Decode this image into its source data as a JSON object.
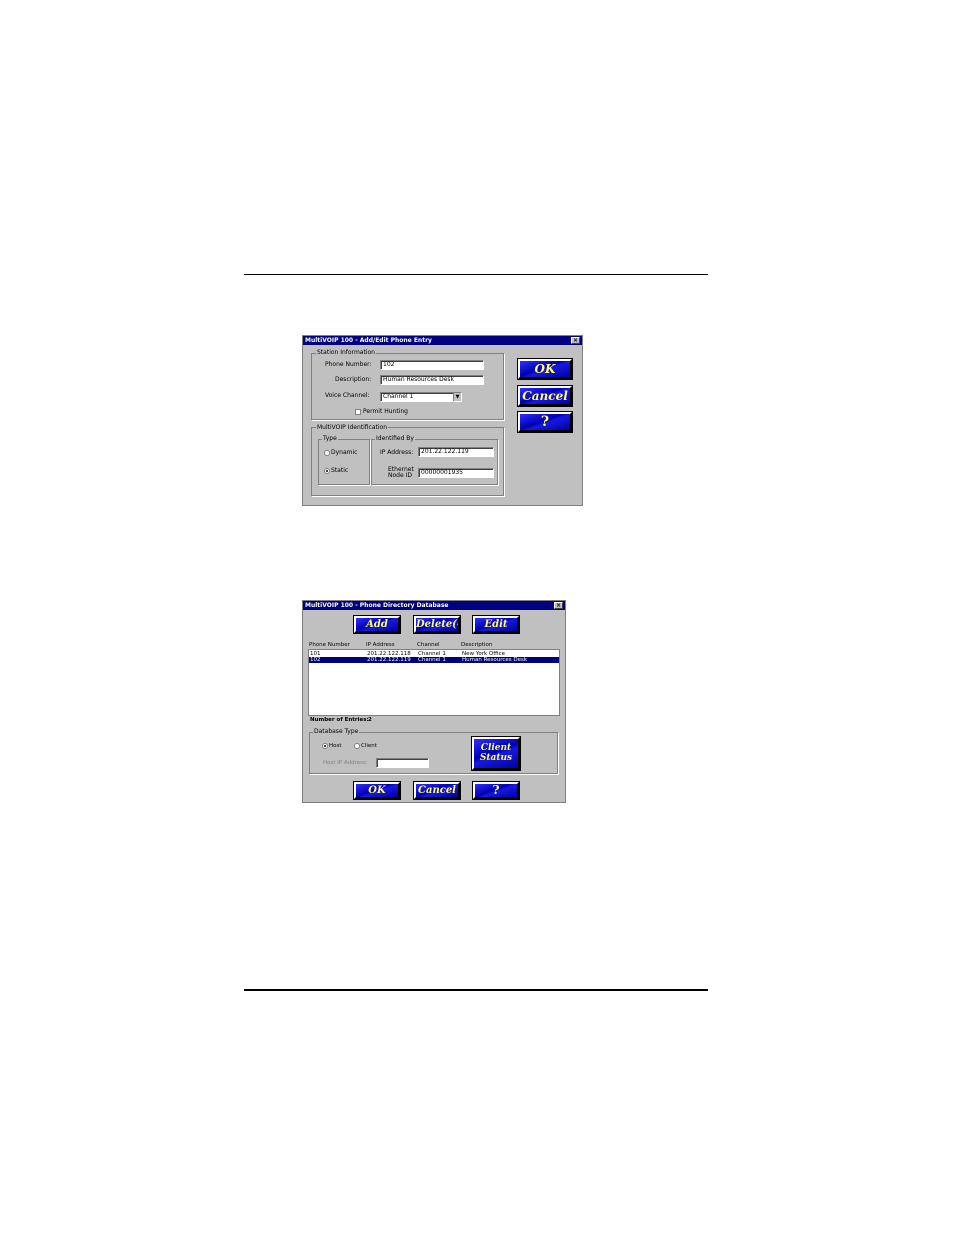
{
  "edit_dialog": {
    "title": "MultiVOIP 100 - Add/Edit Phone Entry",
    "close": "×",
    "station_group": "Station Information",
    "phone_number_label": "Phone Number:",
    "phone_number_value": "102",
    "description_label": "Description:",
    "description_value": "Human Resources Desk",
    "voice_channel_label": "Voice Channel:",
    "voice_channel_value": "Channel 1",
    "permit_hunting_label": "Permit Hunting",
    "id_group": "MultiVOIP Identification",
    "type_label": "Type",
    "identified_by_label": "Identified By",
    "dynamic_label": "Dynamic",
    "static_label": "Static",
    "ip_address_label": "IP Address:",
    "ip_address_value": "201.22.122.119",
    "ethernet_label_1": "Ethernet",
    "ethernet_label_2": "Node ID",
    "ethernet_value": "00000001935",
    "ok_label": "OK",
    "cancel_label": "Cancel",
    "help_label": "?"
  },
  "dir_dialog": {
    "title": "MultiVOIP 100 - Phone Directory Database",
    "close": "×",
    "add_label": "Add (+)",
    "delete_label": "Delete(-)",
    "edit_label": "Edit",
    "columns": [
      "Phone Number",
      "IP Address",
      "Channel",
      "Description"
    ],
    "rows": [
      {
        "phone": "101",
        "ip": "201.22.122.118",
        "channel": "Channel 1",
        "desc": "New York Office"
      },
      {
        "phone": "102",
        "ip": "201.22.122.119",
        "channel": "Channel 1",
        "desc": "Human Resources Desk"
      }
    ],
    "num_entries_label": "Number of Entries:",
    "num_entries_value": "2",
    "db_type_label": "Database Type",
    "host_label": "Host",
    "client_label": "Client",
    "host_ip_label": "Host IP Address:",
    "client_status_1": "Client",
    "client_status_2": "Status",
    "ok_label": "OK",
    "cancel_label": "Cancel",
    "help_label": "?"
  }
}
